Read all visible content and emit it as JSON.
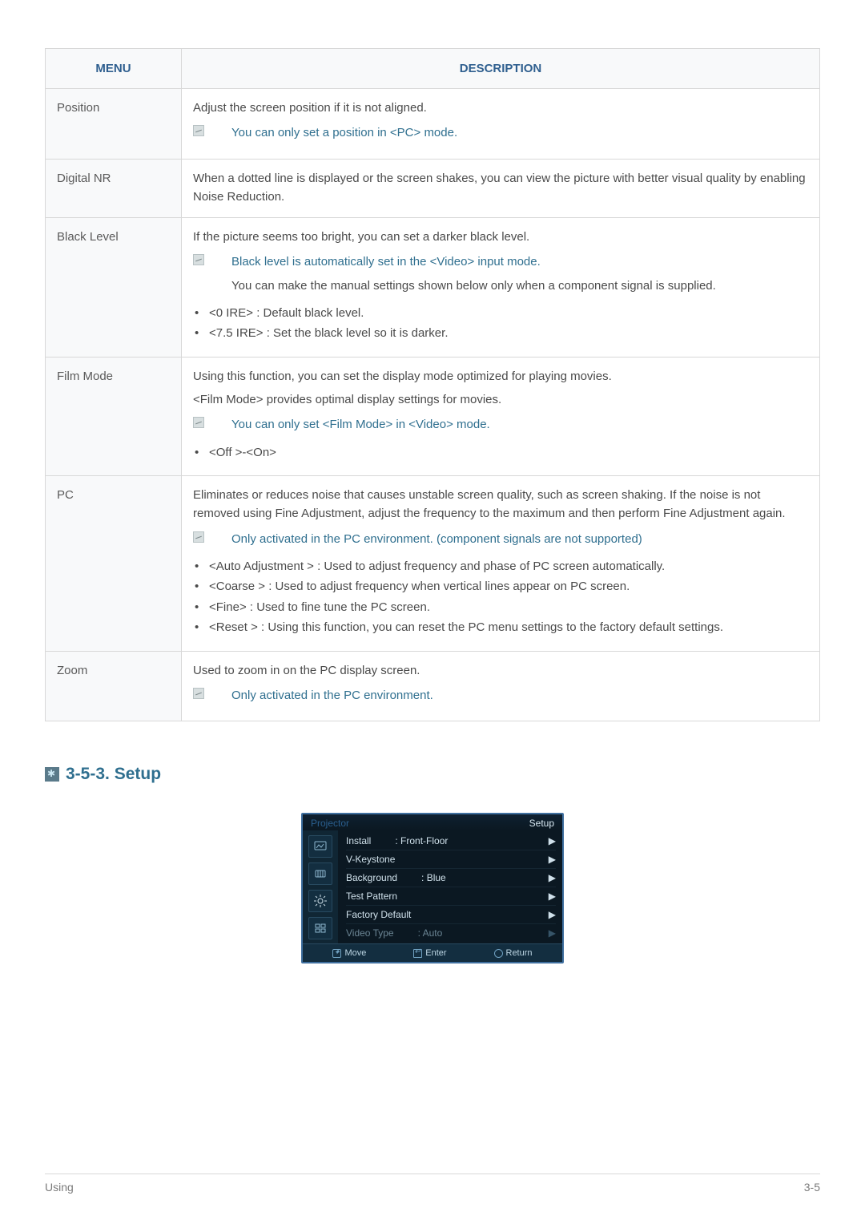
{
  "table": {
    "headers": {
      "menu": "MENU",
      "description": "DESCRIPTION"
    },
    "rows": {
      "position": {
        "menu": "Position",
        "body": "Adjust the screen position if it is not aligned.",
        "note": "You can only set a position in <PC> mode."
      },
      "digital_nr": {
        "menu": "Digital NR",
        "body": "When a dotted line is displayed or the screen shakes, you can view the picture with better visual quality by enabling Noise Reduction."
      },
      "black_level": {
        "menu": "Black Level",
        "body": "If the picture seems too bright, you can set a darker black level.",
        "note": "Black level is automatically set in the <Video> input mode.",
        "note_sub": "You can make the manual settings shown below only when a component signal is supplied.",
        "bullets": [
          "<0 IRE> : Default black level.",
          "<7.5 IRE> : Set the black level so it is darker."
        ]
      },
      "film_mode": {
        "menu": "Film Mode",
        "body1": "Using this function, you can set the display mode optimized for playing movies.",
        "body2": "<Film Mode> provides optimal display settings for movies.",
        "note": "You can only set <Film Mode> in <Video> mode.",
        "bullets": [
          "<Off >-<On>"
        ]
      },
      "pc": {
        "menu": "PC",
        "body": "Eliminates or reduces noise that causes unstable screen quality, such as screen shaking. If the noise is not removed using Fine Adjustment, adjust the frequency to the maximum and then perform Fine Adjustment again.",
        "note": "Only activated in the PC environment. (component signals are not supported)",
        "bullets": [
          "<Auto Adjustment > : Used to adjust frequency and phase of PC screen automatically.",
          "<Coarse > : Used to adjust frequency when vertical lines appear on PC screen.",
          "<Fine> : Used to fine tune the PC screen.",
          "<Reset > : Using this function, you can reset the PC menu settings to the factory default settings."
        ]
      },
      "zoom": {
        "menu": "Zoom",
        "body": "Used to zoom in on the PC display screen.",
        "note": "Only activated in the PC environment."
      }
    }
  },
  "section_heading": "3-5-3. Setup",
  "osd": {
    "top_left": "Projector",
    "top_right": "Setup",
    "items": [
      {
        "label": "Install",
        "value": ": Front-Floor",
        "dim": false
      },
      {
        "label": "V-Keystone",
        "value": "",
        "dim": false
      },
      {
        "label": "Background",
        "value": ": Blue",
        "dim": false
      },
      {
        "label": "Test Pattern",
        "value": "",
        "dim": false
      },
      {
        "label": "Factory Default",
        "value": "",
        "dim": false
      },
      {
        "label": "Video Type",
        "value": ": Auto",
        "dim": true
      }
    ],
    "footer": {
      "move": "Move",
      "enter": "Enter",
      "return": "Return"
    }
  },
  "footer": {
    "left": "Using",
    "right": "3-5"
  }
}
